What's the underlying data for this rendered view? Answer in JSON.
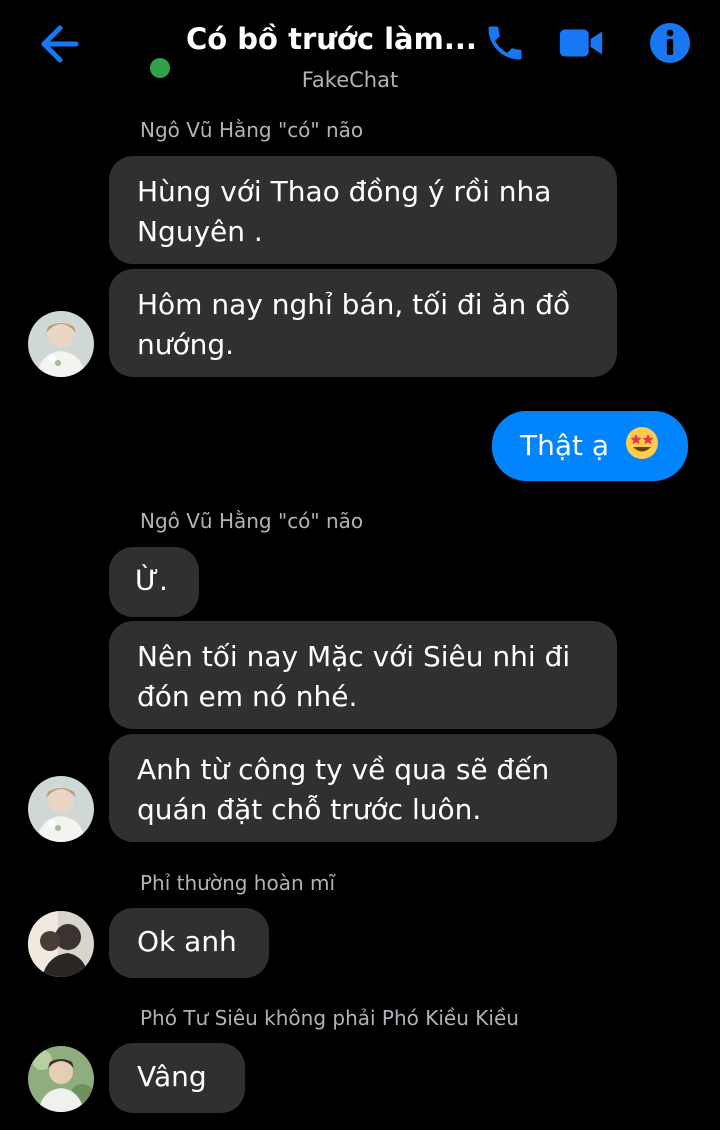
{
  "header": {
    "title": "Có bồ trước làm...",
    "subtitle": "FakeChat",
    "colors": {
      "accent": "#1877f2",
      "online": "#31a24c"
    },
    "icons": [
      "back-arrow-icon",
      "phone-icon",
      "video-icon",
      "info-icon"
    ]
  },
  "messages": [
    {
      "sender": "Ngô Vũ Hằng \"có\" não"
    },
    {
      "text": "Hùng với Thao đồng ý rồi nha Nguyên ."
    },
    {
      "text": "Hôm nay nghỉ bán, tối đi ăn đồ nướng."
    },
    {
      "text": "Thật ạ",
      "emoji": "star-struck-emoji"
    },
    {
      "sender": "Ngô Vũ Hằng \"có\" não"
    },
    {
      "text": "Ừ."
    },
    {
      "text": "Nên tối nay Mặc với Siêu nhi đi đón em nó nhé."
    },
    {
      "text": "Anh từ công ty về qua sẽ đến quán đặt chỗ trước luôn."
    },
    {
      "sender": "Phỉ thường hoàn mĩ"
    },
    {
      "text": "Ok anh"
    },
    {
      "sender": "Phó Tư Siêu không phải Phó Kiều Kiều"
    },
    {
      "text": "Vâng"
    }
  ],
  "colors": {
    "bubble_other": "#303030",
    "bubble_mine": "#0084ff",
    "background": "#000000",
    "meta_text": "#b0b3b8"
  }
}
